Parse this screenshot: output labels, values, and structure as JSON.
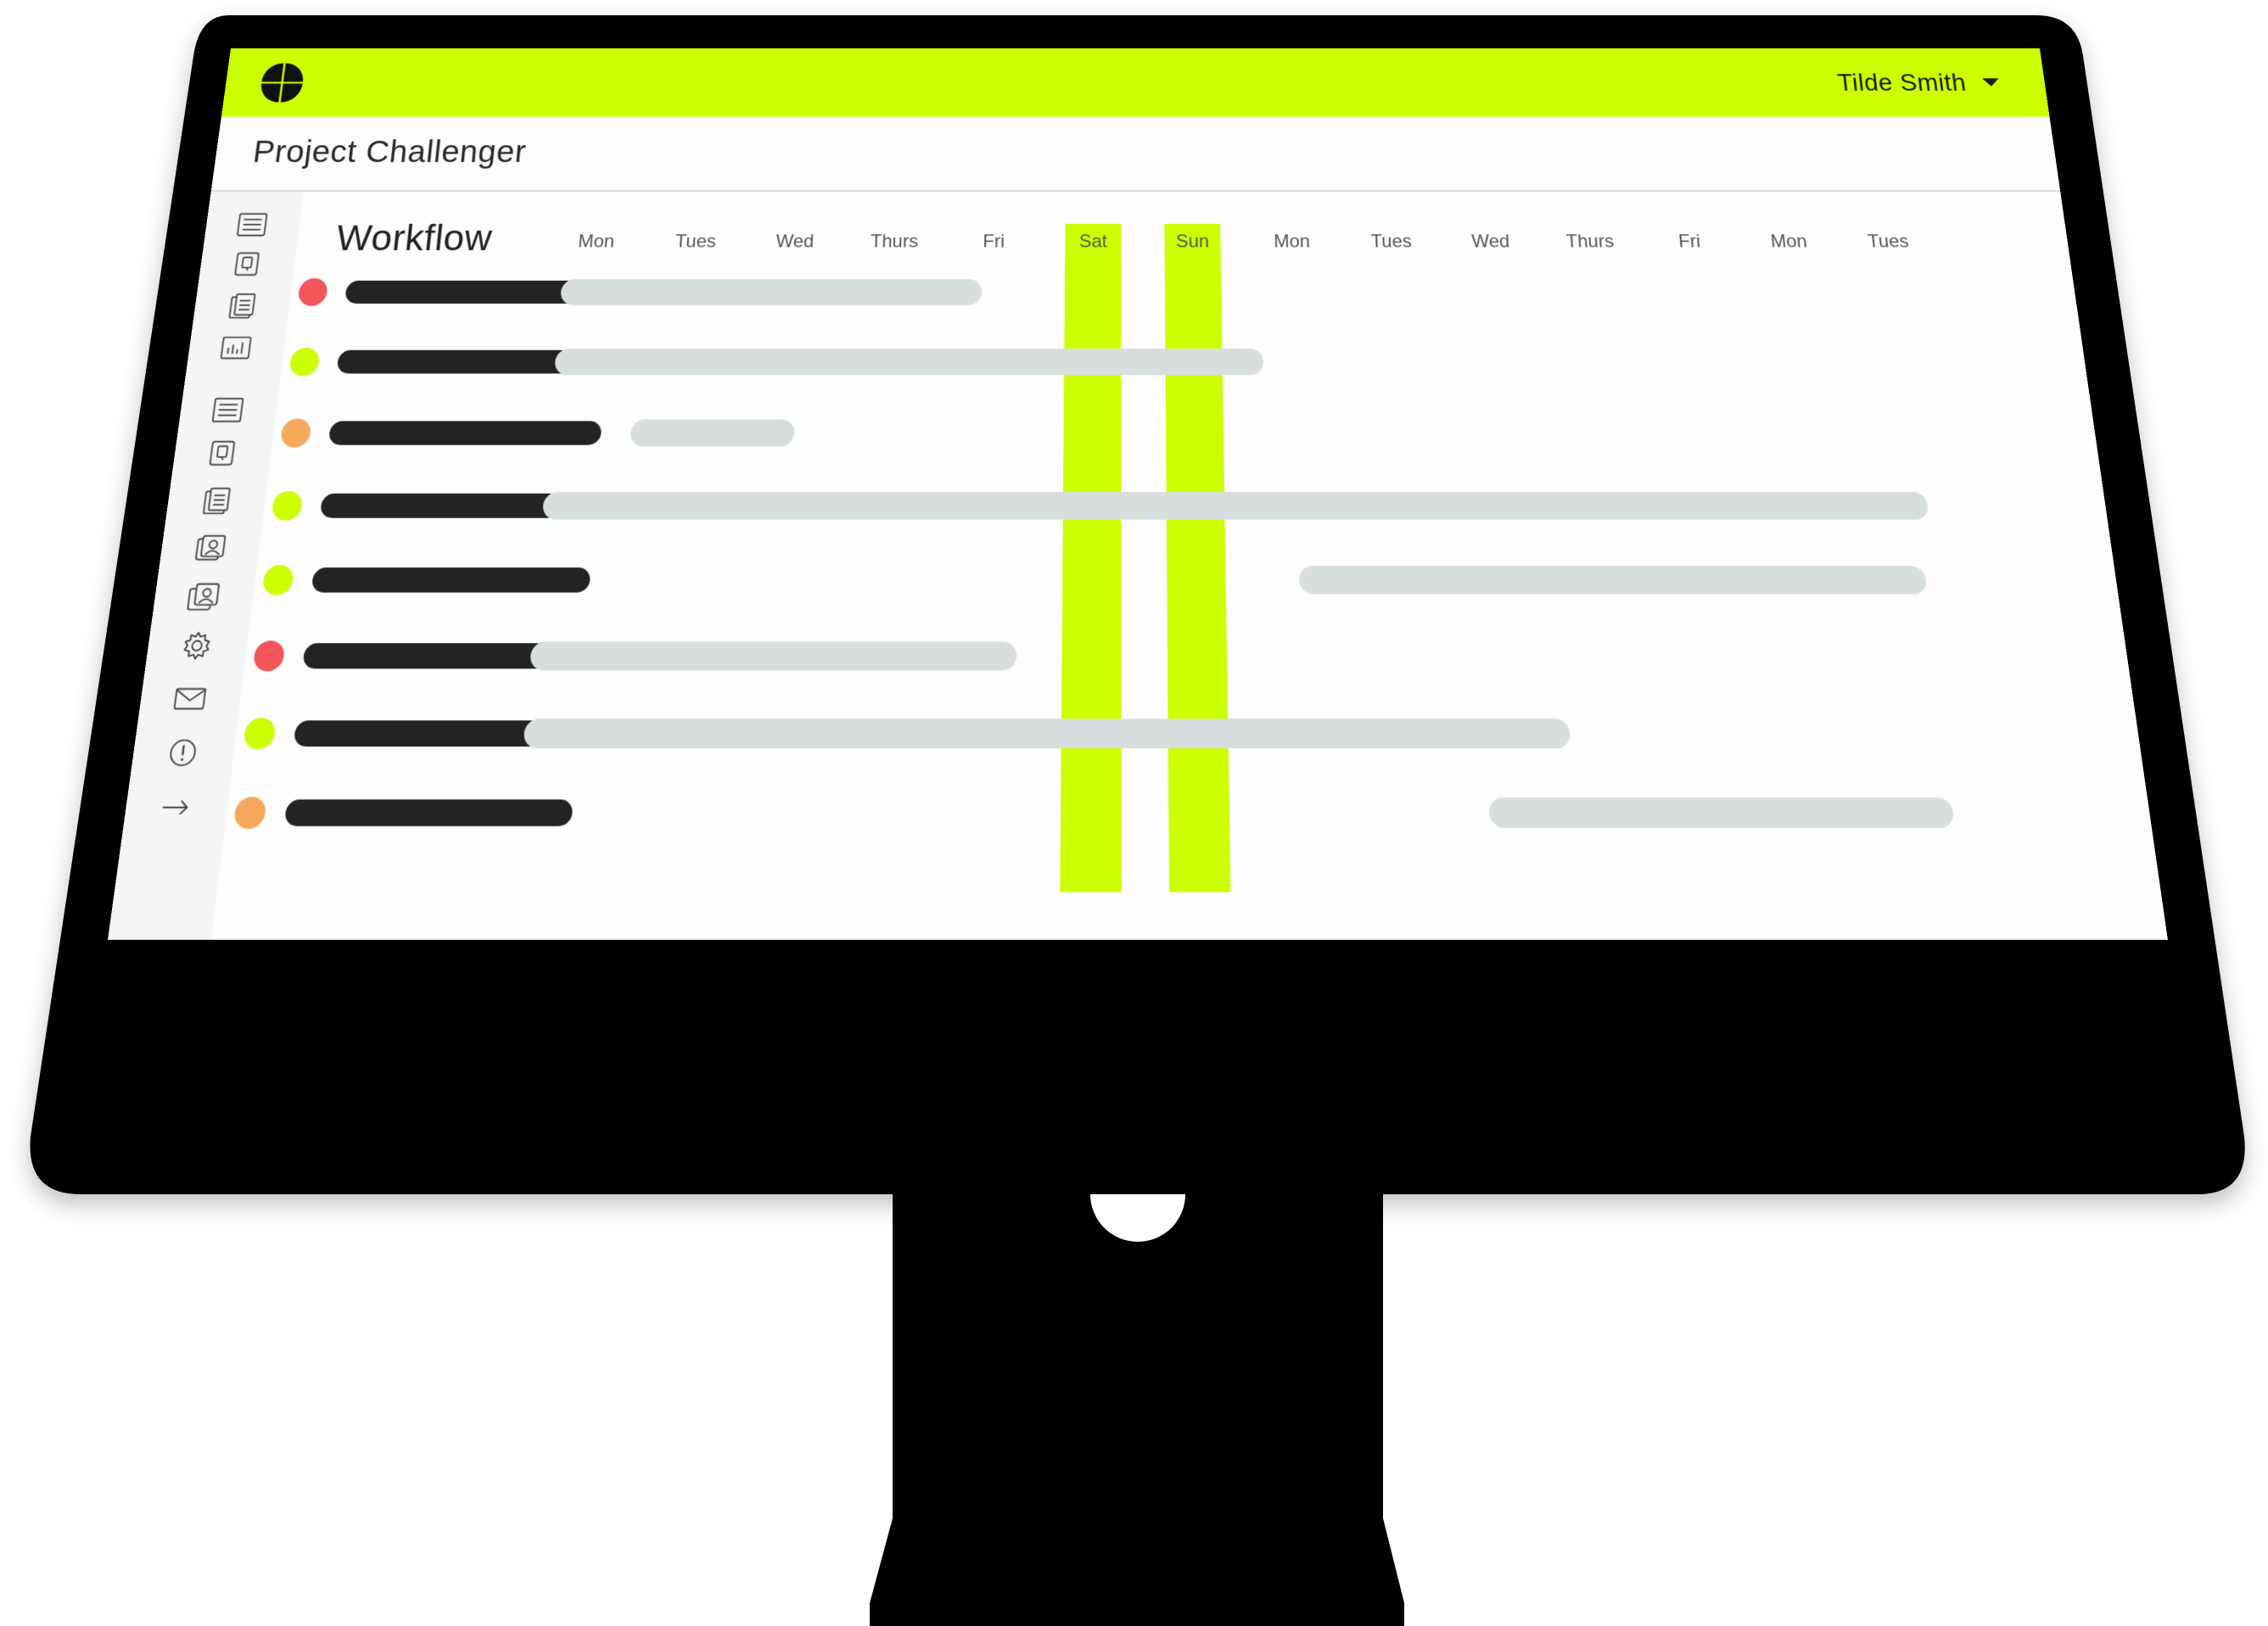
{
  "app": {
    "project_title": "Project Challenger",
    "user_name": "Tilde Smith",
    "accent_color": "#ccff00"
  },
  "workflow": {
    "title": "Workflow",
    "days": [
      "Mon",
      "Tues",
      "Wed",
      "Thurs",
      "Fri",
      "Sat",
      "Sun",
      "Mon",
      "Tues",
      "Wed",
      "Thurs",
      "Fri",
      "Mon",
      "Tues"
    ],
    "highlighted_days": [
      "Sat",
      "Sun"
    ],
    "tasks": [
      {
        "status": "red",
        "status_color": "#f2555a",
        "start_day": 0,
        "end_day": 4.2
      },
      {
        "status": "green",
        "status_color": "#ccff00",
        "start_day": 0,
        "end_day": 7.0
      },
      {
        "status": "orange",
        "status_color": "#f7a85c",
        "start_day": 0.8,
        "end_day": 2.4
      },
      {
        "status": "green",
        "status_color": "#ccff00",
        "start_day": 0,
        "end_day": 13.4
      },
      {
        "status": "green",
        "status_color": "#ccff00",
        "start_day": 7.3,
        "end_day": 13.3
      },
      {
        "status": "red",
        "status_color": "#f2555a",
        "start_day": 0,
        "end_day": 4.6
      },
      {
        "status": "green",
        "status_color": "#ccff00",
        "start_day": 0,
        "end_day": 9.8
      },
      {
        "status": "orange",
        "status_color": "#f7a85c",
        "start_day": 9.0,
        "end_day": 13.3
      }
    ]
  },
  "sidebar": {
    "icons": [
      "list-icon",
      "document-icon",
      "clipboard-icon",
      "chart-icon",
      "list-icon",
      "document-icon",
      "clipboard-icon",
      "user-card-icon",
      "user-cards-icon",
      "gear-icon",
      "mail-icon",
      "alert-icon",
      "arrow-right-icon"
    ]
  }
}
